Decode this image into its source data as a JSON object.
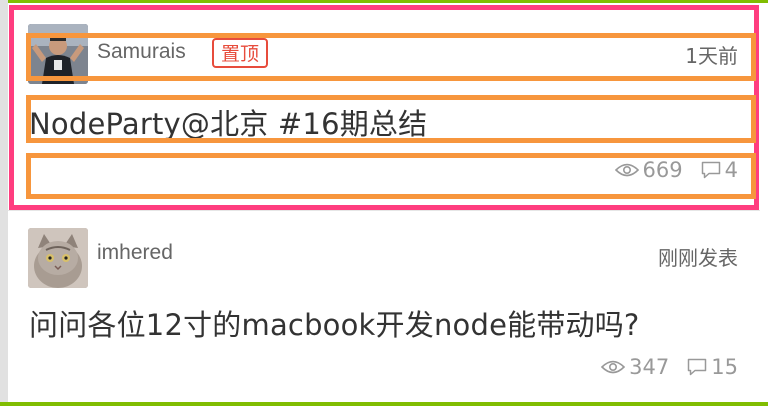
{
  "colors": {
    "accent_green": "#80bd01",
    "highlight_pink": "#ff3d7f",
    "selection_orange": "#f7963d",
    "pin_red": "#e74c3c",
    "text_gray": "#666666",
    "meta_gray": "#999999"
  },
  "topics": [
    {
      "author": "Samurais",
      "badge": "置顶",
      "time": "1天前",
      "title": "NodeParty@北京 #16期总结",
      "views": "669",
      "replies": "4",
      "icons": {
        "views": "eye-icon",
        "replies": "comment-icon"
      }
    },
    {
      "author": "imhered",
      "time": "刚刚发表",
      "title": "问问各位12寸的macbook开发node能带动吗?",
      "views": "347",
      "replies": "15",
      "icons": {
        "views": "eye-icon",
        "replies": "comment-icon"
      }
    }
  ]
}
